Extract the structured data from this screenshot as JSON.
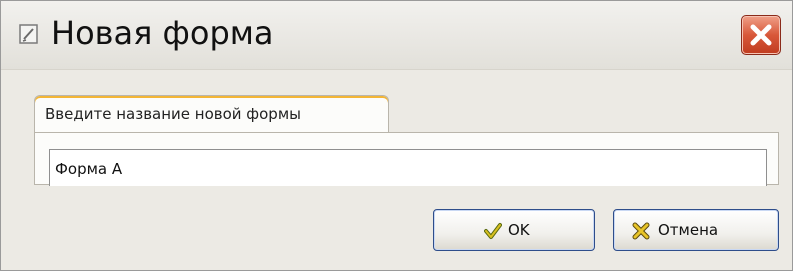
{
  "window": {
    "title": "Новая форма",
    "icons": {
      "title": "form-icon",
      "close": "close-icon"
    },
    "colors": {
      "close_button": "#d8583a",
      "tab_accent": "#f3b535",
      "button_border": "#2e4d8a"
    }
  },
  "tab": {
    "label": "Введите название новой формы"
  },
  "form_name_field": {
    "value": "Форма А"
  },
  "buttons": {
    "ok": {
      "label": "OK",
      "icon": "checkmark-icon"
    },
    "cancel": {
      "label": "Отмена",
      "icon": "cross-icon"
    }
  }
}
